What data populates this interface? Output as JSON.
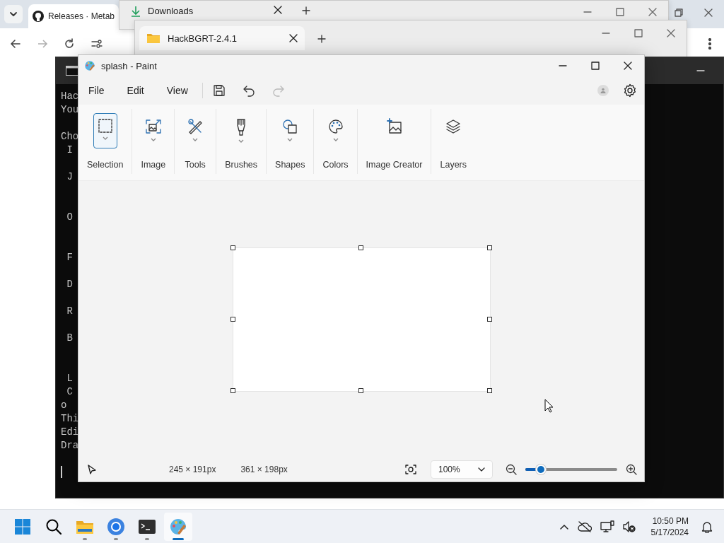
{
  "browser": {
    "tabs": [
      {
        "title": "Releases · Metab",
        "selected": true
      }
    ]
  },
  "downloads_window": {
    "tab": {
      "title": "Downloads"
    }
  },
  "explorer_window": {
    "tab": {
      "title": "HackBGRT-2.4.1"
    }
  },
  "terminal": {
    "blocks": [
      {
        "kind": "short",
        "lines": [
          "Hac",
          "You"
        ]
      },
      {
        "kind": "short",
        "lines": [
          "Cho",
          " I"
        ]
      },
      {
        "kind": "long",
        "lines": [
          " J"
        ]
      },
      {
        "kind": "long",
        "lines": [
          " O"
        ]
      },
      {
        "kind": "short",
        "lines": [
          " F"
        ]
      },
      {
        "kind": "short",
        "lines": [
          " D"
        ]
      },
      {
        "kind": "short",
        "lines": [
          " R"
        ]
      },
      {
        "kind": "long",
        "lines": [
          " B"
        ]
      },
      {
        "kind": "short",
        "lines": [
          " L",
          " C",
          "o",
          "Thi",
          "Edi",
          "Dra"
        ]
      }
    ]
  },
  "paint": {
    "title": "splash - Paint",
    "menu": [
      "File",
      "Edit",
      "View"
    ],
    "actions": [
      {
        "kind": "save",
        "disabled": false
      },
      {
        "kind": "undo",
        "disabled": false
      },
      {
        "kind": "redo",
        "disabled": true
      }
    ],
    "ribbon": [
      {
        "kind": "selection",
        "label": "Selection",
        "selected": true,
        "dropdown": true
      },
      {
        "kind": "image",
        "label": "Image",
        "selected": false,
        "dropdown": true
      },
      {
        "kind": "tools",
        "label": "Tools",
        "selected": false,
        "dropdown": true
      },
      {
        "kind": "brushes",
        "label": "Brushes",
        "selected": false,
        "dropdown": true
      },
      {
        "kind": "shapes",
        "label": "Shapes",
        "selected": false,
        "dropdown": true
      },
      {
        "kind": "colors",
        "label": "Colors",
        "selected": false,
        "dropdown": true
      },
      {
        "kind": "image_creator",
        "label": "Image Creator",
        "selected": false,
        "dropdown": false
      },
      {
        "kind": "layers",
        "label": "Layers",
        "selected": false,
        "dropdown": false
      }
    ],
    "status": {
      "cursor_position": "245 × 191px",
      "canvas_size": "361 × 198px",
      "zoom": "100%",
      "zoom_slider": {
        "level": 0.17
      }
    }
  },
  "taskbar": {
    "apps": [
      {
        "kind": "start",
        "selected": false
      },
      {
        "kind": "search",
        "selected": false
      },
      {
        "kind": "explorer",
        "selected": false
      },
      {
        "kind": "browser",
        "selected": false
      },
      {
        "kind": "terminal",
        "selected": false
      },
      {
        "kind": "paint",
        "selected": true
      }
    ],
    "clock": {
      "time": "10:50 PM",
      "date": "5/17/2024"
    }
  }
}
